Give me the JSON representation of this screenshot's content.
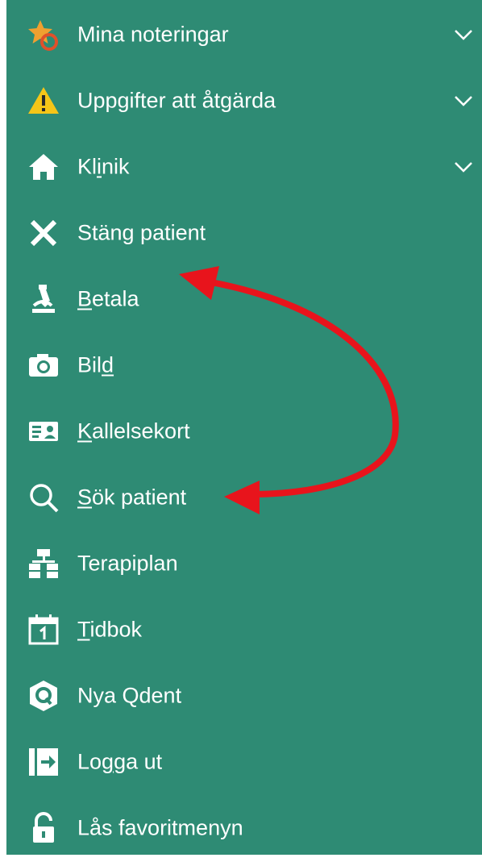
{
  "menu": {
    "items": [
      {
        "id": "mina-noteringar",
        "label": "Mina noteringar",
        "icon": "star-note-icon",
        "expandable": true
      },
      {
        "id": "uppgifter",
        "label": "Uppgifter att åtgärda",
        "icon": "warning-icon",
        "expandable": true
      },
      {
        "id": "klinik",
        "label_pre": "Kl",
        "label_u": "i",
        "label_post": "nik",
        "icon": "home-icon",
        "expandable": true
      },
      {
        "id": "stang-patient",
        "label": "Stäng patient",
        "icon": "close-icon",
        "expandable": false
      },
      {
        "id": "betala",
        "label_pre": "",
        "label_u": "B",
        "label_post": "etala",
        "icon": "microscope-icon",
        "expandable": false
      },
      {
        "id": "bild",
        "label_pre": "Bil",
        "label_u": "d",
        "label_post": "",
        "icon": "camera-icon",
        "expandable": false
      },
      {
        "id": "kallelsekort",
        "label_pre": "",
        "label_u": "K",
        "label_post": "allelsekort",
        "icon": "id-card-icon",
        "expandable": false
      },
      {
        "id": "sok-patient",
        "label_pre": "",
        "label_u": "S",
        "label_post": "ök patient",
        "icon": "search-icon",
        "expandable": false
      },
      {
        "id": "terapiplan",
        "label": "Terapiplan",
        "icon": "hierarchy-icon",
        "expandable": false
      },
      {
        "id": "tidbok",
        "label_pre": "",
        "label_u": "T",
        "label_post": "idbok",
        "icon": "calendar-icon",
        "expandable": false
      },
      {
        "id": "nya-qdent",
        "label": "Nya Qdent",
        "icon": "qdent-logo-icon",
        "expandable": false
      },
      {
        "id": "logga-ut",
        "label_pre": "Lo",
        "label_u": "g",
        "label_post": "ga ut",
        "icon": "logout-icon",
        "expandable": false
      },
      {
        "id": "las-favoritmenyn",
        "label": "Lås favoritmenyn",
        "icon": "unlock-icon",
        "expandable": false
      }
    ]
  },
  "colors": {
    "panel_bg": "#2e8b74",
    "text": "#ffffff",
    "warning": "#f5c518",
    "star": "#f0a030",
    "badge": "#e0502a",
    "annotation_arrow": "#e8141c"
  }
}
